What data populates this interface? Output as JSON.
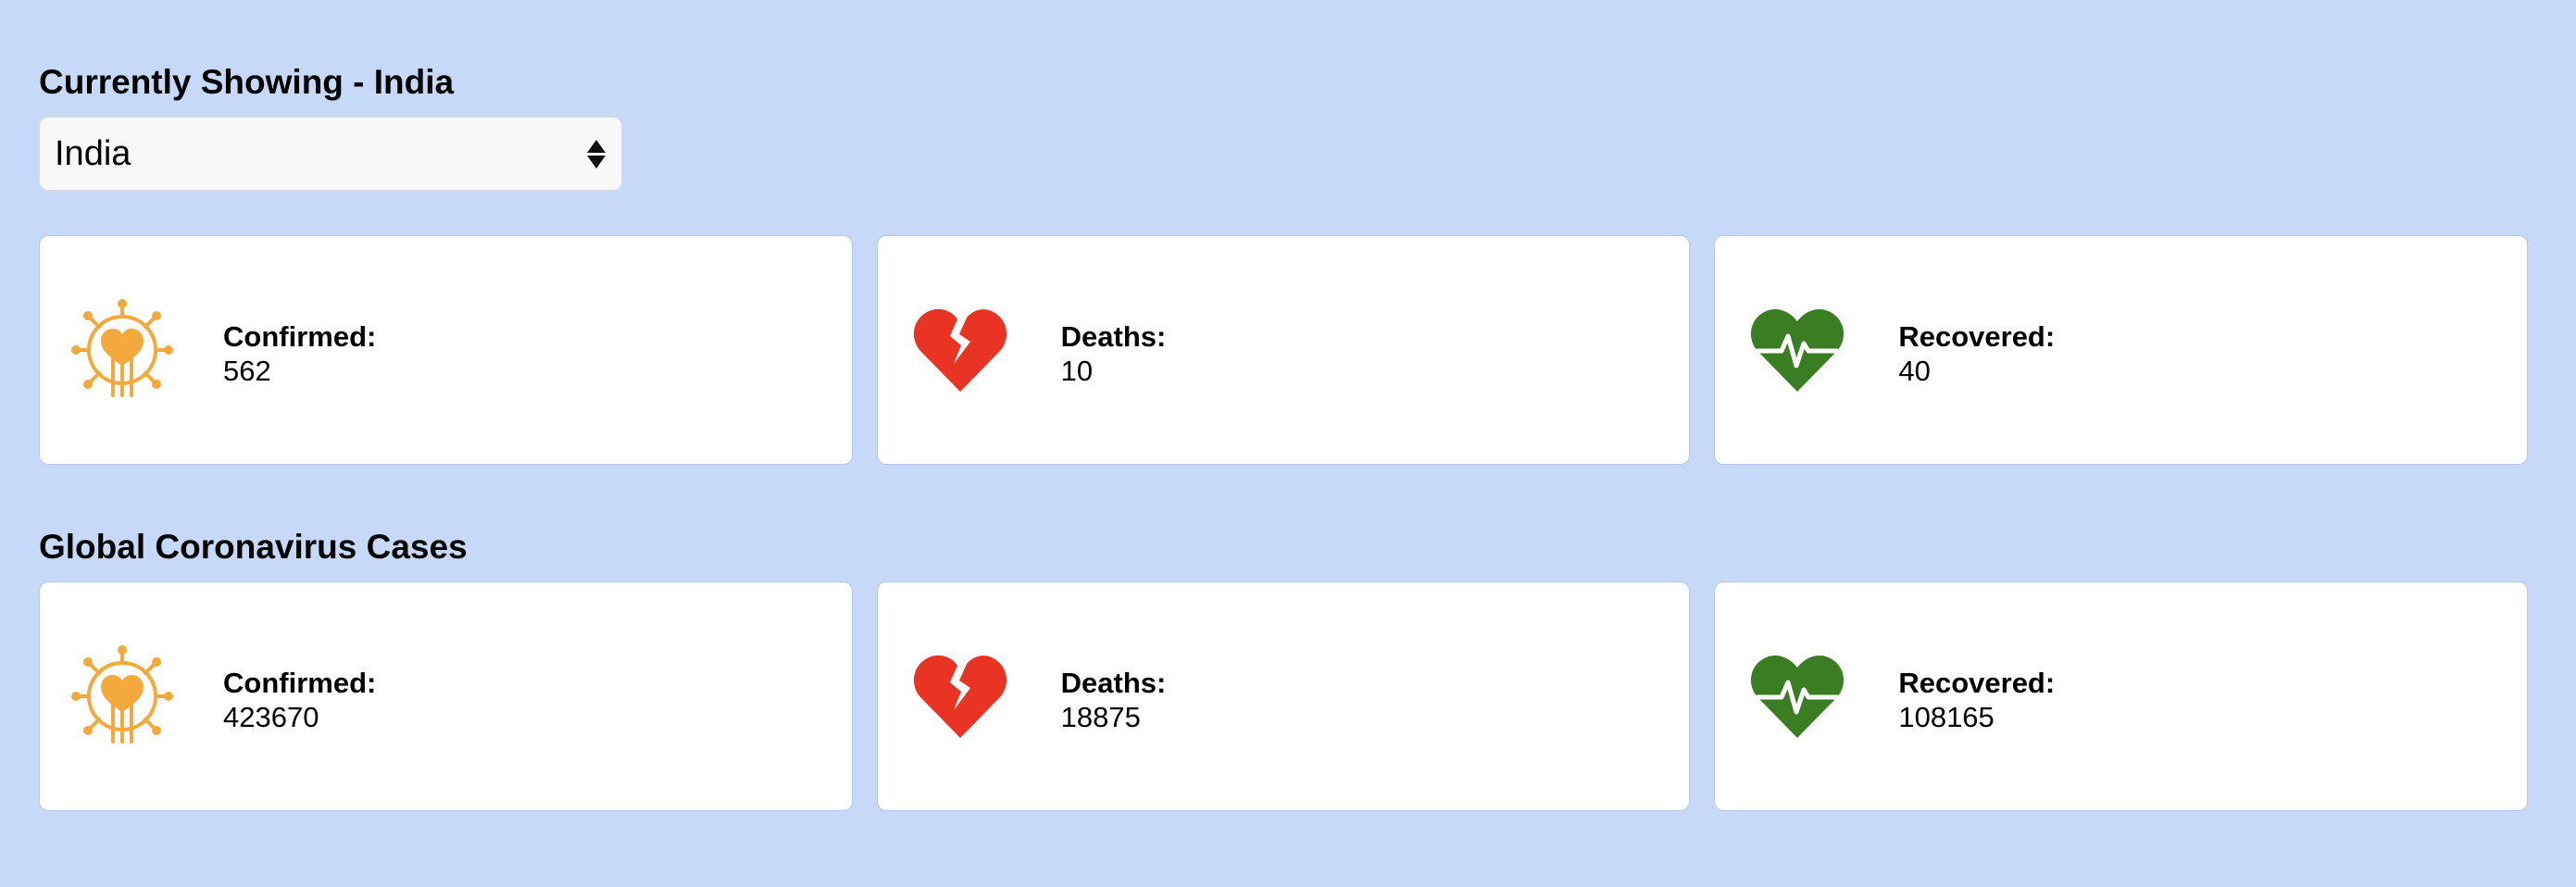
{
  "current": {
    "title": "Currently Showing - India",
    "select_value": "India",
    "stats": {
      "confirmed": {
        "label": "Confirmed:",
        "value": "562"
      },
      "deaths": {
        "label": "Deaths:",
        "value": "10"
      },
      "recovered": {
        "label": "Recovered:",
        "value": "40"
      }
    }
  },
  "global": {
    "title": "Global Coronavirus Cases",
    "stats": {
      "confirmed": {
        "label": "Confirmed:",
        "value": "423670"
      },
      "deaths": {
        "label": "Deaths:",
        "value": "18875"
      },
      "recovered": {
        "label": "Recovered:",
        "value": "108165"
      }
    }
  },
  "icons": {
    "confirmed": "virus-icon",
    "deaths": "broken-heart-icon",
    "recovered": "heartbeat-icon"
  },
  "colors": {
    "background": "#c6d9f9",
    "confirmed": "#f3a93c",
    "deaths": "#e93323",
    "recovered": "#3b7d23"
  }
}
